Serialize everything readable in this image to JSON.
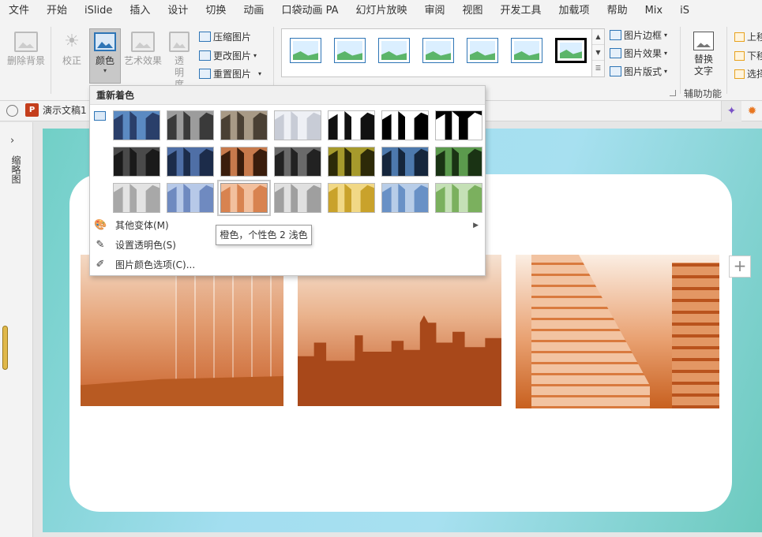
{
  "menu": [
    "文件",
    "开始",
    "iSlide",
    "插入",
    "设计",
    "切换",
    "动画",
    "口袋动画 PA",
    "幻灯片放映",
    "审阅",
    "视图",
    "开发工具",
    "加载项",
    "帮助",
    "Mix",
    "iS"
  ],
  "ribbon": {
    "remove_bg": "删除背景",
    "correct": "校正",
    "color": "颜色",
    "artistic": "艺术效果",
    "transparency": "透明度",
    "compress": "压缩图片",
    "change": "更改图片",
    "reset": "重置图片",
    "border": "图片边框",
    "effects": "图片效果",
    "layout": "图片版式",
    "alt_text": "替换文字",
    "group_accessibility": "辅助功能",
    "bring_forward": "上移",
    "send_backward": "下移",
    "selection": "选择"
  },
  "tabbar": {
    "doc_name": "演示文稿1",
    "app_abbr": "P"
  },
  "leftpane": {
    "label": "缩略图"
  },
  "dropdown": {
    "title": "重新着色",
    "swatches": [
      {
        "name": "No Recolor",
        "bg": "#5b8ac2",
        "fg": "#2a3f6a"
      },
      {
        "name": "Grayscale",
        "bg": "#9c9c9c",
        "fg": "#3a3a3a"
      },
      {
        "name": "Sepia",
        "bg": "#a89a86",
        "fg": "#4a4034"
      },
      {
        "name": "Washout",
        "bg": "#eef0f5",
        "fg": "#c8ccd6"
      },
      {
        "name": "Black and White 25%",
        "bg": "#ffffff",
        "fg": "#111111"
      },
      {
        "name": "Black and White 50%",
        "bg": "#ffffff",
        "fg": "#000000"
      },
      {
        "name": "Black and White 75%",
        "bg": "#000000",
        "fg": "#ffffff"
      },
      {
        "name": "Dark variation 1",
        "bg": "#4a4a4a",
        "fg": "#1a1a1a"
      },
      {
        "name": "Dark variation 2",
        "bg": "#4f6fa6",
        "fg": "#1c2c4a"
      },
      {
        "name": "Dark variation 3",
        "bg": "#c77a4c",
        "fg": "#3a1d0c"
      },
      {
        "name": "Dark variation 4",
        "bg": "#6a6a6a",
        "fg": "#222222"
      },
      {
        "name": "Dark variation 5",
        "bg": "#a69a2c",
        "fg": "#2d2a08"
      },
      {
        "name": "Dark variation 6",
        "bg": "#4d79ad",
        "fg": "#15263c"
      },
      {
        "name": "Dark variation 7",
        "bg": "#5b9a4d",
        "fg": "#1a3314"
      },
      {
        "name": "Light variation 1",
        "bg": "#e3e3e3",
        "fg": "#a8a8a8"
      },
      {
        "name": "Light variation 2",
        "bg": "#b7c9e8",
        "fg": "#6f8ac0"
      },
      {
        "name": "Light variation 3",
        "bg": "#f2c09e",
        "fg": "#d88350"
      },
      {
        "name": "Light variation 4",
        "bg": "#e0e0e0",
        "fg": "#9f9f9f"
      },
      {
        "name": "Light variation 5",
        "bg": "#f1d886",
        "fg": "#c9a22b"
      },
      {
        "name": "Light variation 6",
        "bg": "#b8cde8",
        "fg": "#6991c6"
      },
      {
        "name": "Light variation 7",
        "bg": "#c5e0b6",
        "fg": "#7bb05e"
      }
    ],
    "items": [
      {
        "label": "其他变体(M)",
        "icon": "palette-icon",
        "glyph": "🎨",
        "has_submenu": true
      },
      {
        "label": "设置透明色(S)",
        "icon": "set-transparent-color-icon",
        "glyph": "✎",
        "has_submenu": false
      },
      {
        "label": "图片颜色选项(C)...",
        "icon": "picture-color-options-icon",
        "glyph": "✐",
        "has_submenu": false
      }
    ],
    "tooltip": "橙色，个性色 2 浅色"
  },
  "gallery_colors": [
    "#2e75b6",
    "#2e75b6",
    "#2e75b6",
    "#2e75b6",
    "#2e75b6",
    "#2e75b6",
    "#000000"
  ]
}
